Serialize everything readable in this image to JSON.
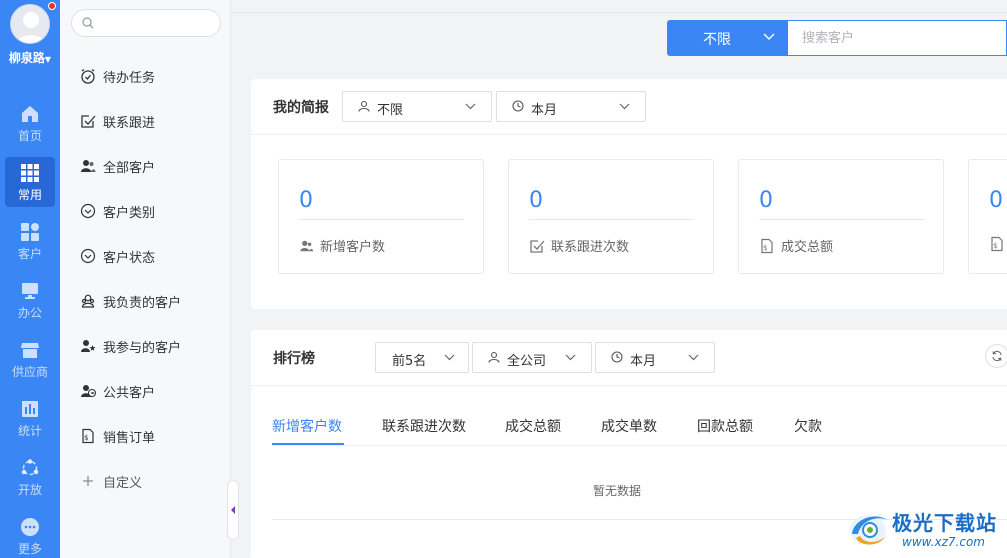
{
  "nav": {
    "user_name": "柳泉路",
    "items": [
      {
        "label": "首页",
        "icon": "home-icon"
      },
      {
        "label": "常用",
        "icon": "grid-icon",
        "active": true
      },
      {
        "label": "客户",
        "icon": "apps-icon"
      },
      {
        "label": "办公",
        "icon": "monitor-icon"
      },
      {
        "label": "供应商",
        "icon": "store-icon"
      },
      {
        "label": "统计",
        "icon": "stats-icon"
      },
      {
        "label": "开放",
        "icon": "open-icon"
      },
      {
        "label": "更多",
        "icon": "more-icon"
      }
    ]
  },
  "menu": {
    "search_placeholder": "",
    "items": [
      {
        "label": "待办任务",
        "icon": "alarm-clock-icon"
      },
      {
        "label": "联系跟进",
        "icon": "checkbox-icon"
      },
      {
        "label": "全部客户",
        "icon": "users-icon"
      },
      {
        "label": "客户类别",
        "icon": "chevron-circle-icon"
      },
      {
        "label": "客户状态",
        "icon": "chevron-circle-icon"
      },
      {
        "label": "我负责的客户",
        "icon": "user-group-icon"
      },
      {
        "label": "我参与的客户",
        "icon": "user-star-icon"
      },
      {
        "label": "公共客户",
        "icon": "user-share-icon"
      },
      {
        "label": "销售订单",
        "icon": "order-icon"
      },
      {
        "label": "自定义",
        "icon": "plus-icon"
      }
    ]
  },
  "topbar": {
    "scope_value": "不限",
    "search_placeholder": "搜索客户"
  },
  "brief": {
    "title": "我的简报",
    "person_filter": "不限",
    "period_filter": "本月",
    "cards": [
      {
        "value": "0",
        "label": "新增客户数",
        "icon": "users-icon"
      },
      {
        "value": "0",
        "label": "联系跟进次数",
        "icon": "checkbox-icon"
      },
      {
        "value": "0",
        "label": "成交总额",
        "icon": "order-icon"
      },
      {
        "value": "0",
        "label": "",
        "icon": "order-icon"
      }
    ]
  },
  "ranking": {
    "title": "排行榜",
    "top_filter": "前5名",
    "scope_filter": "全公司",
    "period_filter": "本月",
    "tabs": [
      "新增客户数",
      "联系跟进次数",
      "成交总额",
      "成交单数",
      "回款总额",
      "欠款"
    ],
    "active_tab": 0,
    "empty_text": "暂无数据"
  },
  "watermark": {
    "name": "极光下载站",
    "url": "www.xz7.com"
  },
  "colors": {
    "accent": "#3b86f5",
    "nav_active": "#2868d6",
    "badge": "#e8332b"
  }
}
